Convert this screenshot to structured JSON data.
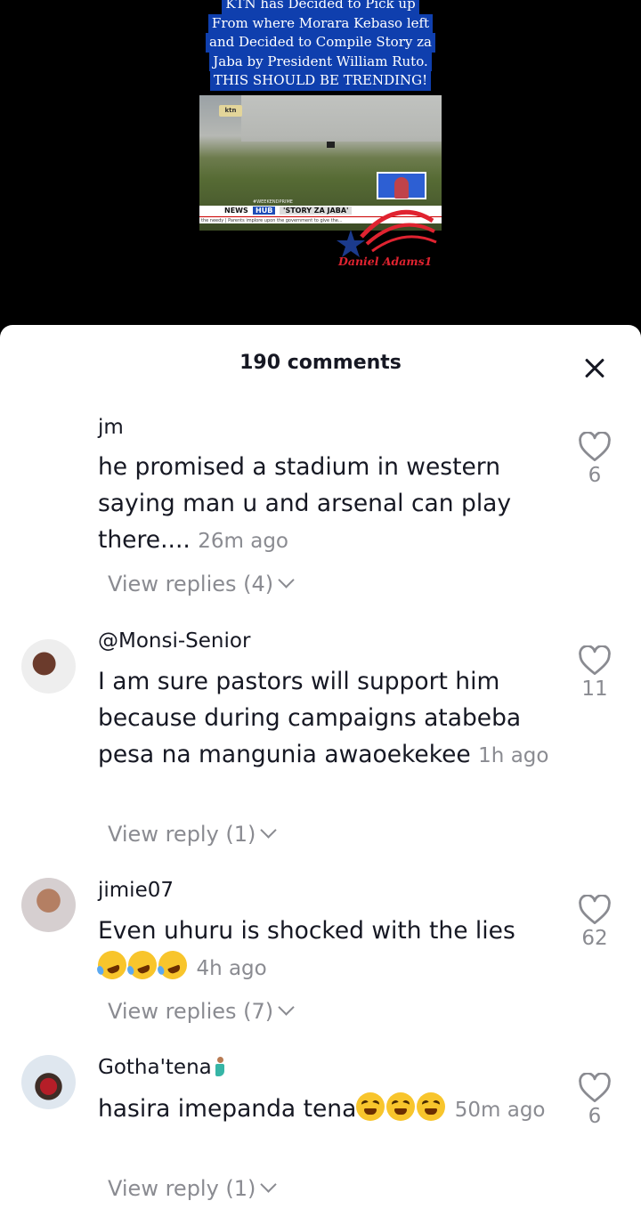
{
  "video": {
    "caption_lines": [
      "KTN has Decided to Pick up",
      "From where Morara Kebaso left",
      "and Decided to Compile Story za",
      "Jaba by President William Ruto.",
      "THIS SHOULD BE TRENDING!"
    ],
    "frame": {
      "channel_logo": "ktn",
      "hashtag": "#WEEKENDPRIME",
      "ticker_news": "NEWS",
      "ticker_hub": "HUB",
      "ticker_story": "'STORY ZA JABA'",
      "ticker_sub": "the needy | Parents implore upon the government to give the..."
    },
    "watermark": "Daniel Adams1"
  },
  "comments_sheet": {
    "title": "190 comments",
    "comments": [
      {
        "username": "jm",
        "text": "he promised a stadium in western saying man u and arsenal can play there....",
        "time": "26m ago",
        "replies": "View replies (4)",
        "likes": "6"
      },
      {
        "username": "@Monsi-Senior",
        "text": "I am sure pastors will support him because during campaigns atabeba pesa na mangunia awaoekekee",
        "time": "1h ago",
        "replies": "View reply (1)",
        "likes": "11"
      },
      {
        "username": "jimie07",
        "text": "Even uhuru is shocked with the lies",
        "time": "4h ago",
        "replies": "View replies (7)",
        "likes": "62"
      },
      {
        "username": "Gotha'tena",
        "text": "hasira imepanda tena",
        "time": "50m ago",
        "replies": "View reply (1)",
        "likes": "6"
      }
    ]
  }
}
